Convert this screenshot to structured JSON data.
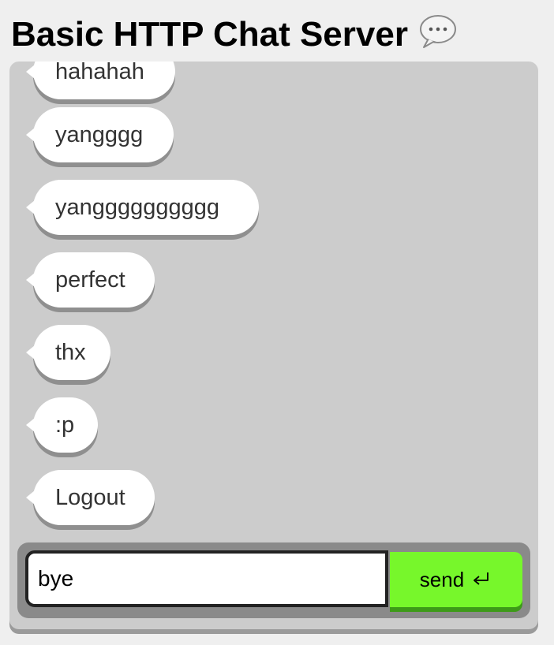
{
  "header": {
    "title": "Basic HTTP Chat Server",
    "icon": "speech-bubble-icon"
  },
  "messages": [
    {
      "text": "hahahah"
    },
    {
      "text": "yangggg"
    },
    {
      "text": "yangggggggggg"
    },
    {
      "text": "perfect"
    },
    {
      "text": "thx"
    },
    {
      "text": ":p"
    },
    {
      "text": "Logout"
    }
  ],
  "composer": {
    "input_value": "bye",
    "send_label": "send",
    "send_icon": "return-arrow-icon",
    "send_color": "#77f72b"
  }
}
